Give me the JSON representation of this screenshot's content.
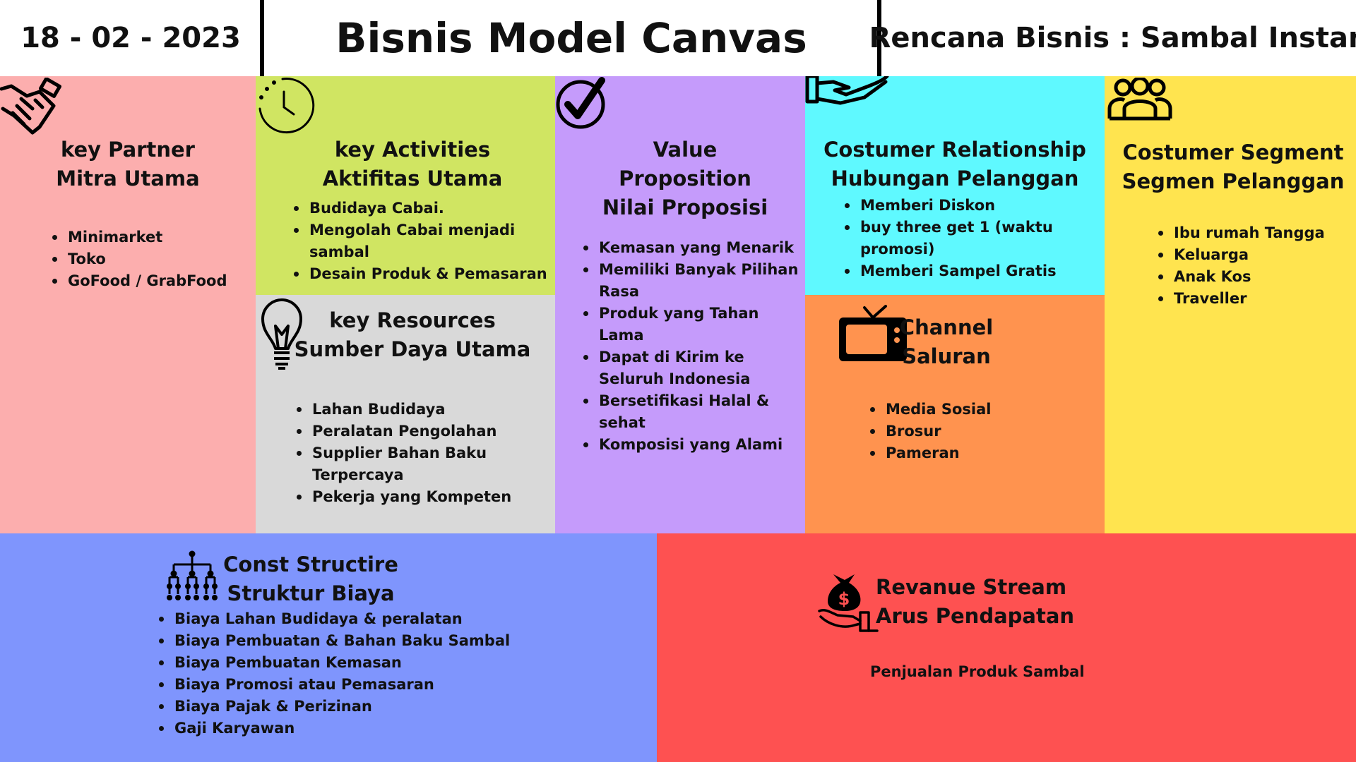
{
  "header": {
    "date": "18 - 02 - 2023",
    "title": "Bisnis Model Canvas",
    "plan": "Rencana Bisnis : Sambal Instan"
  },
  "key_partner": {
    "icon": "handshake-icon",
    "title_1": "key Partner",
    "title_2": "Mitra Utama",
    "items": [
      "Minimarket",
      "Toko",
      "GoFood / GrabFood"
    ]
  },
  "key_activities": {
    "icon": "clock-icon",
    "title_1": "key Activities",
    "title_2": "Aktifitas Utama",
    "items": [
      "Budidaya Cabai.",
      "Mengolah Cabai menjadi sambal",
      "Desain Produk & Pemasaran"
    ]
  },
  "key_resources": {
    "icon": "lightbulb-icon",
    "title_1": "key Resources",
    "title_2": "Sumber Daya Utama",
    "items": [
      "Lahan Budidaya",
      "Peralatan Pengolahan",
      "Supplier Bahan Baku Terpercaya",
      "Pekerja yang Kompeten"
    ]
  },
  "value_proposition": {
    "icon": "checkmark-circle-icon",
    "title_1": "Value",
    "title_2": "Proposition",
    "title_3": "Nilai Proposisi",
    "items": [
      "Kemasan yang Menarik",
      "Memiliki Banyak Pilihan Rasa",
      "Produk yang Tahan Lama",
      "Dapat di Kirim ke Seluruh Indonesia",
      "Bersetifikasi Halal & sehat",
      "Komposisi yang Alami"
    ]
  },
  "customer_relationship": {
    "icon": "open-hand-icon",
    "title_1": "Costumer Relationship",
    "title_2": "Hubungan Pelanggan",
    "items": [
      "Memberi Diskon",
      "buy three get 1 (waktu promosi)",
      "Memberi Sampel Gratis"
    ]
  },
  "channel": {
    "icon": "television-icon",
    "title_1": "Channel",
    "title_2": "Saluran",
    "items": [
      "Media Sosial",
      "Brosur",
      "Pameran"
    ]
  },
  "customer_segment": {
    "icon": "people-group-icon",
    "title_1": "Costumer Segment",
    "title_2": "Segmen Pelanggan",
    "items": [
      "Ibu rumah Tangga",
      "Keluarga",
      "Anak Kos",
      "Traveller"
    ]
  },
  "cost_structure": {
    "icon": "org-chart-icon",
    "title_1": "Const Structire",
    "title_2": "Struktur Biaya",
    "items": [
      "Biaya Lahan Budidaya & peralatan",
      "Biaya Pembuatan & Bahan Baku Sambal",
      "Biaya Pembuatan Kemasan",
      "Biaya Promosi atau Pemasaran",
      "Biaya Pajak & Perizinan",
      "Gaji Karyawan"
    ]
  },
  "revenue_stream": {
    "icon": "money-bag-hand-icon",
    "title_1": "Revanue Stream",
    "title_2": "Arus Pendapatan",
    "text": "Penjualan Produk Sambal"
  },
  "colors": {
    "key_partner": "#fcaeae",
    "key_activities": "#d0e562",
    "key_resources": "#d9d9d9",
    "value_proposition": "#c59bfb",
    "customer_relationship": "#5ff9ff",
    "channel": "#ff934f",
    "customer_segment": "#ffe44f",
    "cost_structure": "#7f95fd",
    "revenue_stream": "#fe5151"
  }
}
